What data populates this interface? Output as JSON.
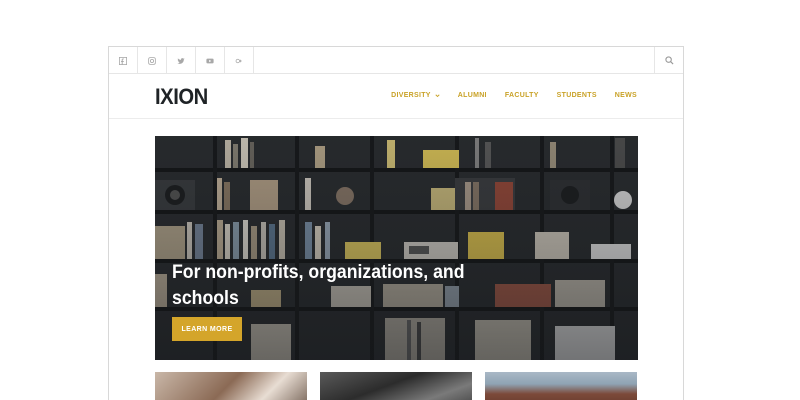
{
  "site": {
    "logo": "IXION"
  },
  "topbar": {
    "social_icons": [
      "facebook-icon",
      "instagram-icon",
      "twitter-icon",
      "youtube-icon",
      "google-plus-icon"
    ],
    "search_icon": "search-icon"
  },
  "nav": {
    "items": [
      {
        "label": "DIVERSITY",
        "has_dropdown": true
      },
      {
        "label": "ALUMNI",
        "has_dropdown": false
      },
      {
        "label": "FACULTY",
        "has_dropdown": false
      },
      {
        "label": "STUDENTS",
        "has_dropdown": false
      },
      {
        "label": "NEWS",
        "has_dropdown": false
      }
    ]
  },
  "hero": {
    "title": "For non-profits, organizations, and schools",
    "button_label": "LEARN MORE"
  },
  "colors": {
    "accent": "#d4a52a",
    "nav_text": "#c9a227",
    "logo_text": "#1f2326",
    "hero_bg": "#2b2e31"
  }
}
